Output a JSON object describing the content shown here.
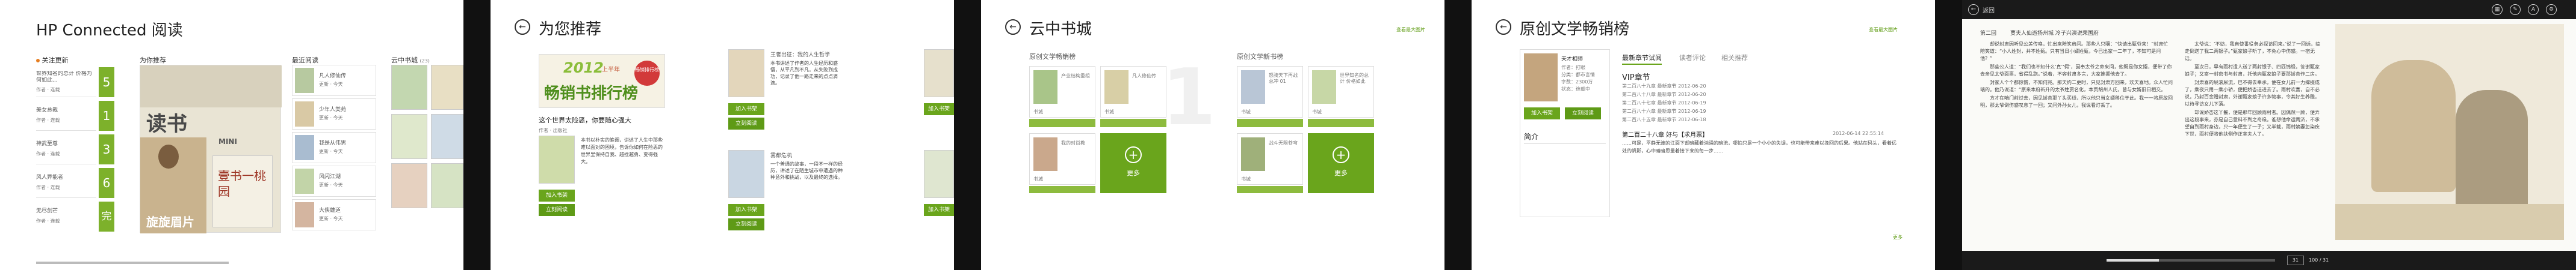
{
  "p1": {
    "title": "HP Connected 阅读",
    "sections": [
      "关注更新",
      "为你推荐",
      "最近阅读",
      "云中书城"
    ],
    "cloud_count": "(23)",
    "follow_items": [
      {
        "title": "世界知名的总计 价格为何如此...",
        "meta": "作者 · 连载"
      },
      {
        "title": "美女总裁",
        "meta": "作者 · 连载"
      },
      {
        "title": "神武至尊",
        "meta": "作者 · 连载"
      },
      {
        "title": "风人异能者",
        "meta": "作者 · 连载"
      },
      {
        "title": "无尽剑芒",
        "meta": "作者 · 连载"
      }
    ],
    "counts": [
      "5",
      "1",
      "3",
      "6",
      "完"
    ],
    "recent_items": [
      {
        "title": "凡人修仙传",
        "meta": "更新 · 今天"
      },
      {
        "title": "少年人类苑",
        "meta": "更新 · 今天"
      },
      {
        "title": "我是从伟男",
        "meta": "更新 · 今天"
      },
      {
        "title": "风闪江湖",
        "meta": "更新 · 今天"
      },
      {
        "title": "大侠雄道",
        "meta": "更新 · 今天"
      }
    ],
    "promo": {
      "big": "读书",
      "mini": "MINI",
      "pic": "旋旋眉片",
      "book": "壹书一桃园"
    }
  },
  "p2": {
    "title": "为您推荐",
    "banner_year": "2012",
    "banner_half": "上半年",
    "banner_main": "畅销书排行榜",
    "banner_badge": "畅销排行榜",
    "book1_title": "这个世界太险恶，你要随心强大",
    "book1_meta": "作者 · 出版社",
    "book1_text": "本书以朴实的笔调，讲述了人生中那些难以面对的困境，告诉你如何在险恶的世界里保持自我、越挫越勇、变得强大。",
    "book2_title": "王者出征：我的人生哲学",
    "book2_text": "本书讲述了作者的人生经历和感悟，从平凡到不凡，从失败到成功，记录了他一路走来的点点滴滴。",
    "book3_title": "雾都危机",
    "book3_text": "一个普通的故事，一段不一样的经历，讲述了在陌生城市中遭遇的种种意外和挑战，以及最终的选择。",
    "add": "加入书架",
    "read": "立刻阅读"
  },
  "p3": {
    "title": "云中书城",
    "top_link": "查看最大图片",
    "col1": "原创文学畅销榜",
    "col2": "原创文学新书榜",
    "books_a": [
      {
        "t": "产业结构重组",
        "m": "书城"
      },
      {
        "t": "凡人修仙传",
        "m": "书城"
      },
      {
        "t": "我的时尚教",
        "m": "书城"
      }
    ],
    "books_b": [
      {
        "t": "怒骑天下再战 总冲 01",
        "m": "书城"
      },
      {
        "t": "世界知名的总计 价格如此",
        "m": "书城"
      },
      {
        "t": "战斗无限苍穹",
        "m": "书城"
      }
    ],
    "more": "更多"
  },
  "p4": {
    "title": "原创文学畅销榜",
    "top_link": "查看最大图片",
    "book_title": "天才相师",
    "book_meta": [
      "作者：打眼",
      "分类：都市言情",
      "字数：2300万",
      "状态：连载中"
    ],
    "add": "加入书架",
    "read": "立刻阅读",
    "intro_title": "简介",
    "tabs": [
      "最新章节试阅",
      "读者评论",
      "相关推荐"
    ],
    "vip": "VIP章节",
    "chapters": [
      "第二百八十九章 最新章节 2012-06-20",
      "第二百八十八章 最新章节 2012-06-20",
      "第二百八十七章 最新章节 2012-06-19",
      "第二百八十六章 最新章节 2012-06-19",
      "第二百八十五章 最新章节 2012-06-18"
    ],
    "featured": "第二百二十八章 好与【求月票】",
    "featured_date": "2012-06-14 22:55:14",
    "featured_text": "……可是，平静无波的江面下却暗藏着汹涌的暗流，哪怕只是一个小小的失误，也可能带来难以挽回的后果。他站在码头，看着远处的帆影，心中暗暗思量着接下来的每一步……",
    "more": "更多"
  },
  "p5": {
    "back": "返回",
    "chapter": "第二回",
    "chapter_title": "贾夫人仙逝扬州城  冷子兴演说荣国府",
    "paragraphs": [
      "却说封肃因听见公差传唤，忙出来陪笑启问。那些人只嚷：“快请出甄爷来！”封肃忙陪笑道：“小人姓封，并不姓甄。只有当日小婿姓甄，今已出家一二年了，不知可是问他？”",
      "那些公人道：“我们也不知什么‘真’‘假’，因奉太爷之命来问，他既是你女婿，便带了你去亲见太爷面禀，省得乱跑。”说着，不容封肃多言，大家推拥他去了。",
      "封家人个个都惊慌，不知何兆。那天约二更时，只见封肃方回来，欢天喜地。众人忙问端的。他乃说道：“原来本府新升的太爷姓贾名化，本贯胡州人氏，曾与女婿旧日相交。",
      "方才在咱门前过去，因见娇杏那丫头买线，所以他只当女婿移住于此。我一一将原故回明，那太爷倒伤感叹息了一回；又问外孙女儿，我说看灯丢了。",
      "太爷说：‘不妨，我自使番役务必探访回来。’说了一回话，临走倒送了我二两银子。”甄家娘子听了，不免心中伤感。一宿无话。",
      "至次日，早有雨村遣人送了两封银子、四匹锦缎，答谢甄家娘子；又寄一封密书与封肃，托他向甄家娘子要那娇杏作二房。",
      "封肃喜的屁滚尿流，巴不得去奉承，便在女儿前一力撺掇成了，乘夜只用一乘小轿，便把娇杏送进去了。雨村欢喜，自不必说，乃封百金赠封肃，外谢甄家娘子许多物事，令其好生养赡，以待寻访女儿下落。",
      "却说娇杏这丫鬟，便是那年回顾雨村者。因偶然一顾，便弄出这段事来，亦是自己意料不到之奇缘。谁想他命运两济，不承望自到雨村身边，只一年便生了一子；又半载，雨村嫡妻忽染疾下世，雨村便将他扶侧作正室夫人了。"
    ],
    "page_info": "31",
    "page_total": "100 / 31"
  }
}
